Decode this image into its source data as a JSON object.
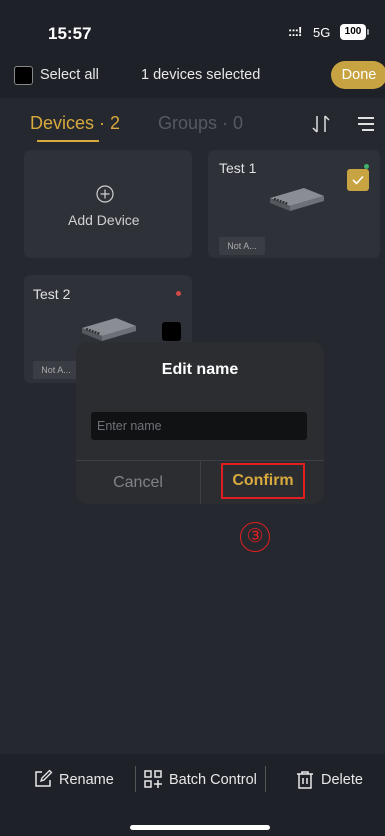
{
  "status_bar": {
    "time": "15:57",
    "signal": ":::!",
    "network": "5G",
    "battery": "100"
  },
  "selection_bar": {
    "select_all_label": "Select all",
    "selected_count": "1 devices selected",
    "done_label": "Done"
  },
  "tabs": [
    {
      "label": "Devices · 2",
      "active": true
    },
    {
      "label": "Groups · 0",
      "active": false
    }
  ],
  "toolbar_icons": [
    "sort-icon",
    "menu-icon"
  ],
  "add_device": {
    "label": "Add Device",
    "icon": "plus-circle-icon"
  },
  "devices": [
    {
      "name": "Test 1",
      "status_color": "#3fb06c",
      "tag": "Not A...",
      "selected": true
    },
    {
      "name": "Test 2",
      "status_color": "#d04848",
      "tag": "Not A...",
      "selected": false
    }
  ],
  "dialog": {
    "title": "Edit name",
    "input_placeholder": "Enter name",
    "input_value": "",
    "cancel_label": "Cancel",
    "confirm_label": "Confirm"
  },
  "annotation": {
    "step_marker": "③"
  },
  "bottom_bar": {
    "rename_label": "Rename",
    "batch_control_label": "Batch Control",
    "delete_label": "Delete"
  },
  "colors": {
    "accent": "#d8a93d",
    "done_button": "#c8a342",
    "highlight": "#e02020"
  }
}
